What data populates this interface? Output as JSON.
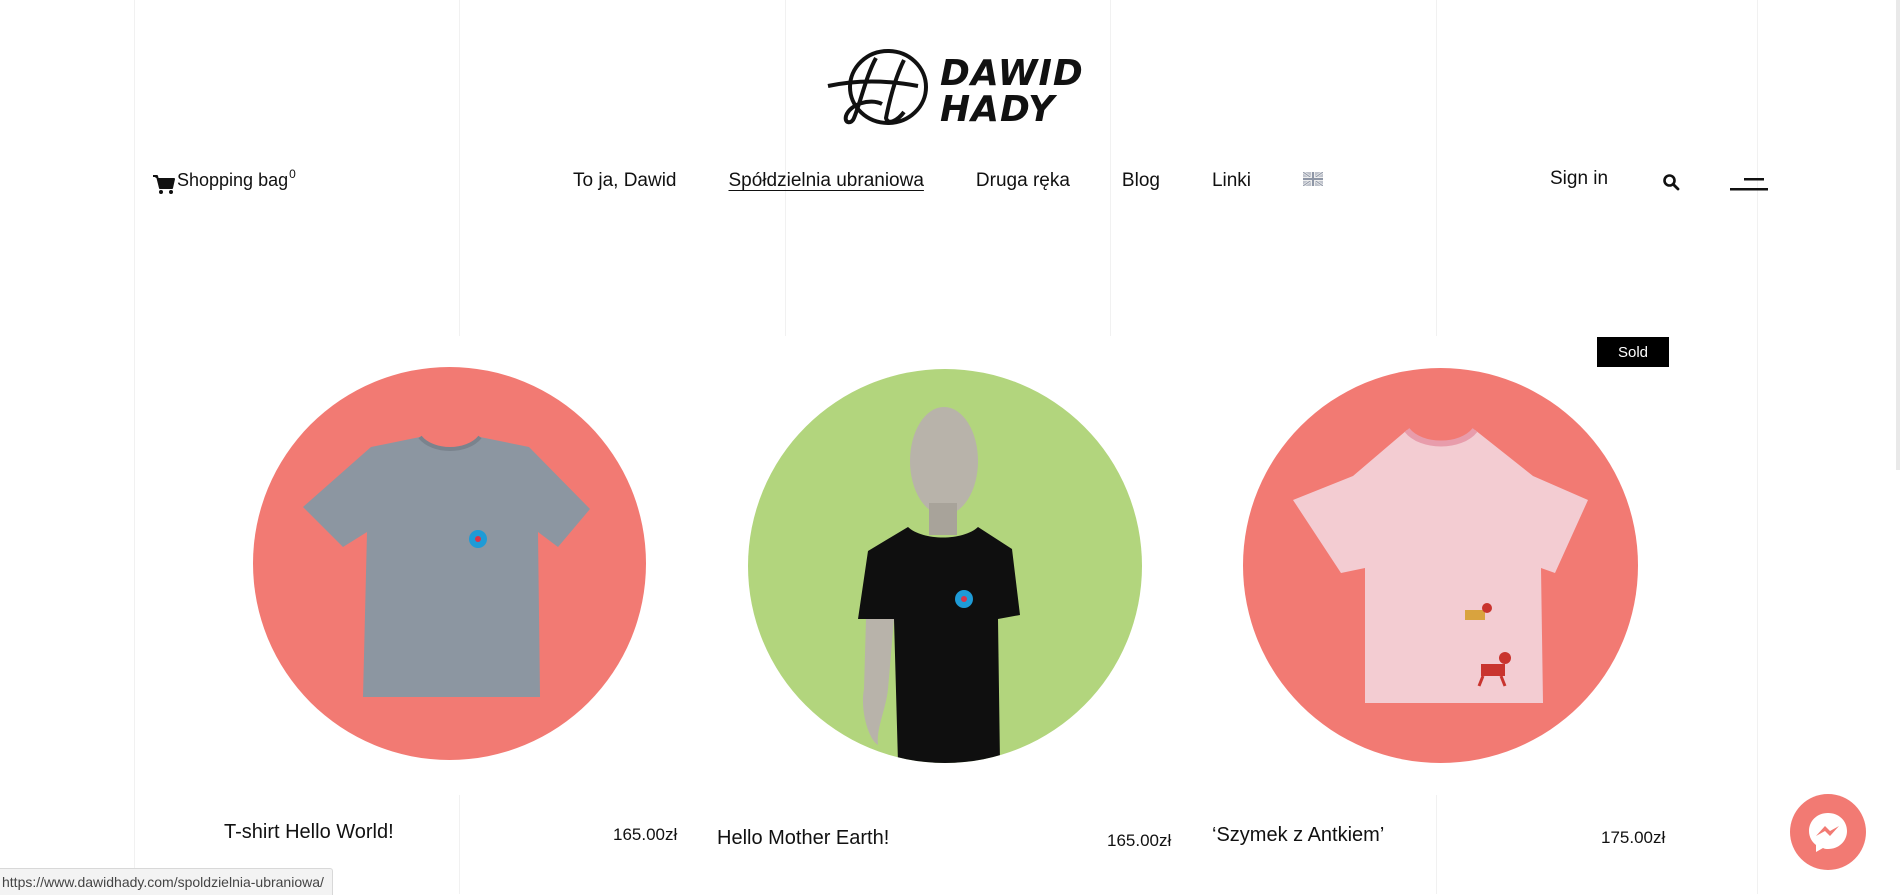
{
  "logo": {
    "line1": "DAWID",
    "line2": "HADY"
  },
  "header": {
    "cart_label": "Shopping bag",
    "cart_count": "0",
    "nav": [
      {
        "label": "To ja, Dawid"
      },
      {
        "label": "Spółdzielnia ubraniowa"
      },
      {
        "label": "Druga ręka"
      },
      {
        "label": "Blog"
      },
      {
        "label": "Linki"
      }
    ],
    "sign_in": "Sign in"
  },
  "products": [
    {
      "title": "T-shirt Hello World!",
      "price": "165.00zł",
      "circle_color": "#f27a73"
    },
    {
      "title": "Hello Mother Earth!",
      "price": "165.00zł",
      "circle_color": "#b2d57d"
    },
    {
      "title": "‘Szymek z Antkiem’",
      "price": "175.00zł",
      "circle_color": "#f27a73",
      "badge": "Sold"
    }
  ],
  "status_bar": {
    "url": "https://www.dawidhady.com/spoldzielnia-ubraniowa/"
  },
  "colors": {
    "accent_coral": "#f27a73",
    "accent_green": "#b2d57d",
    "badge_bg": "#000000"
  }
}
